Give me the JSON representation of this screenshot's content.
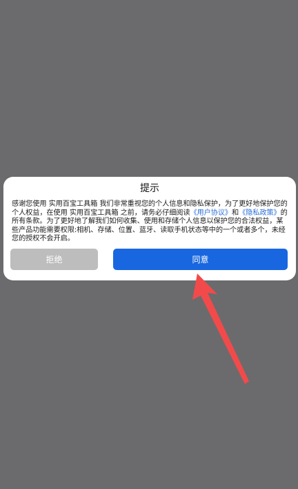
{
  "dialog": {
    "title": "提示",
    "body_part1": "感谢您使用 实用百宝工具箱 我们非常重视您的个人信息和隐私保护，为了更好地保护您的个人权益，在使用 实用百宝工具箱 之前，请务必仔细阅读",
    "link_user_agreement": "《用户协议》",
    "body_and": "和",
    "link_privacy_policy": "《隐私政策》",
    "body_part2": "的所有条款。为了更好地了解我们如何收集、使用和存储个人信息以保护您的合法权益，某些产品功能需要权限:相机、存储、位置、蓝牙、读取手机状态等中的一个或者多个，未经您的授权不会开启。",
    "reject_label": "拒绝",
    "agree_label": "同意"
  },
  "colors": {
    "backdrop": "#6b6b6d",
    "dialog_bg": "#ffffff",
    "link": "#2b6fd9",
    "reject_bg": "#bdbdbd",
    "agree_bg": "#1867e0",
    "annotation_arrow": "#f24a4a"
  }
}
